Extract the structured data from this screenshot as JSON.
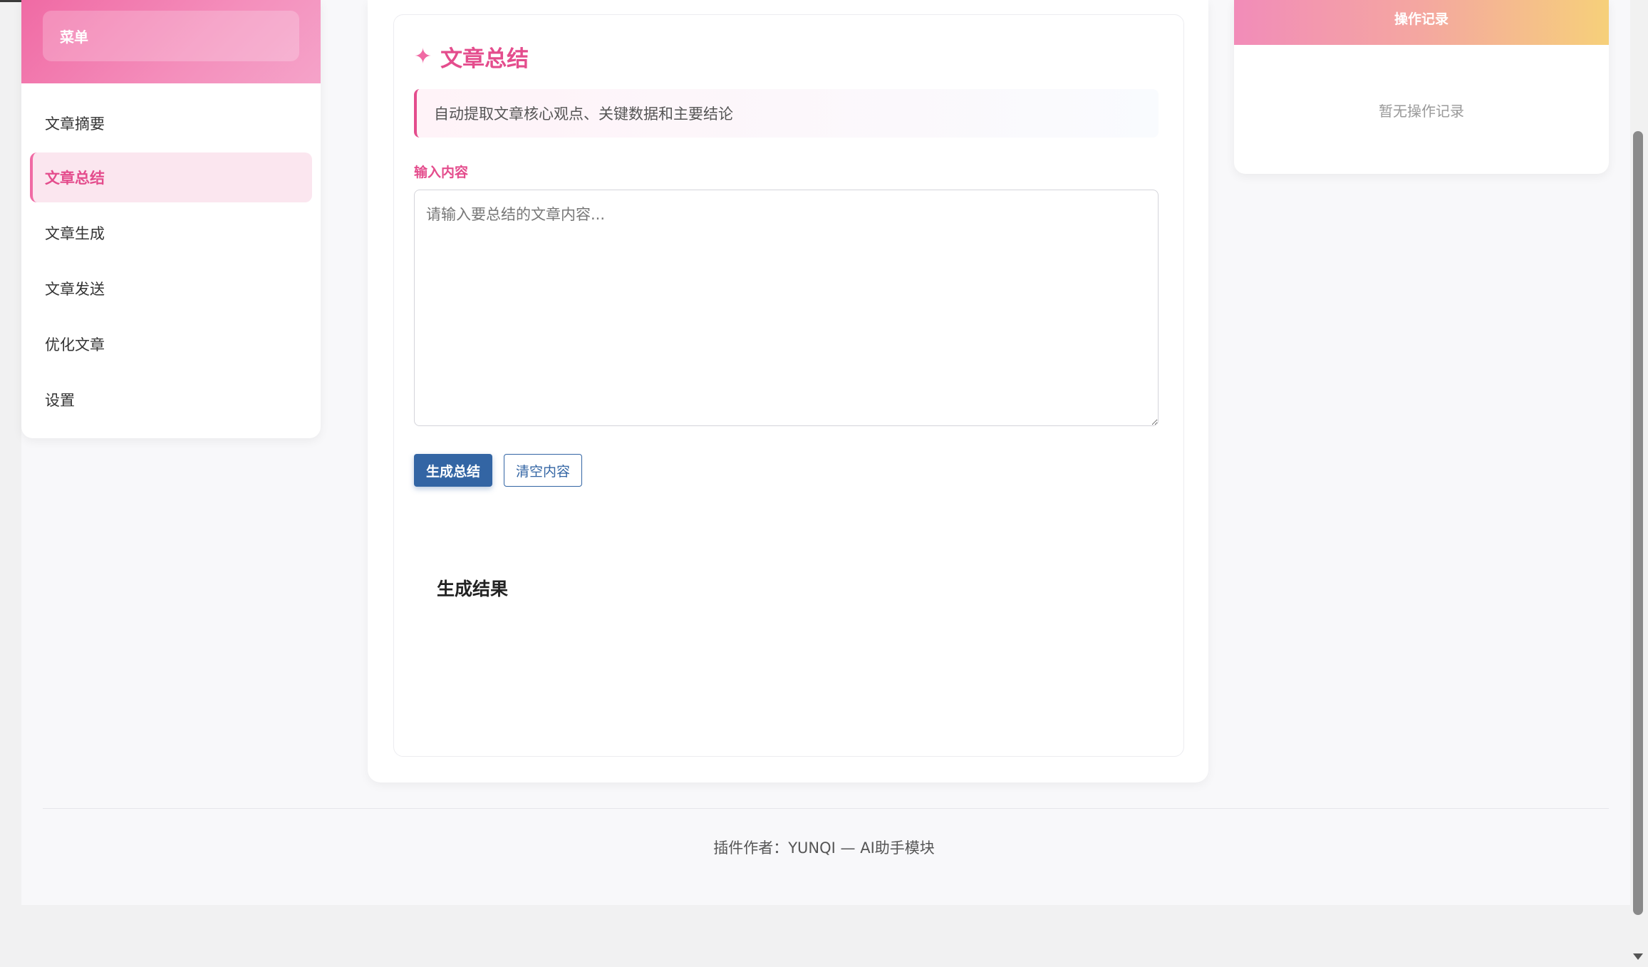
{
  "sidebar": {
    "menu_label": "菜单",
    "items": [
      {
        "label": "文章摘要",
        "active": false
      },
      {
        "label": "文章总结",
        "active": true
      },
      {
        "label": "文章生成",
        "active": false
      },
      {
        "label": "文章发送",
        "active": false
      },
      {
        "label": "优化文章",
        "active": false
      },
      {
        "label": "设置",
        "active": false
      }
    ]
  },
  "main": {
    "title": "文章总结",
    "title_icon": "sparkle-icon",
    "description": "自动提取文章核心观点、关键数据和主要结论",
    "input_label": "输入内容",
    "textarea": {
      "value": "",
      "placeholder": "请输入要总结的文章内容..."
    },
    "generate_button": "生成总结",
    "clear_button": "清空内容",
    "result_title": "生成结果"
  },
  "right_panel": {
    "header": "操作记录",
    "empty_text": "暂无操作记录"
  },
  "footer": {
    "text": "插件作者：YUNQI — AI助手模块"
  },
  "colors": {
    "accent_pink": "#e44d8d",
    "primary_blue": "#3365a4"
  }
}
